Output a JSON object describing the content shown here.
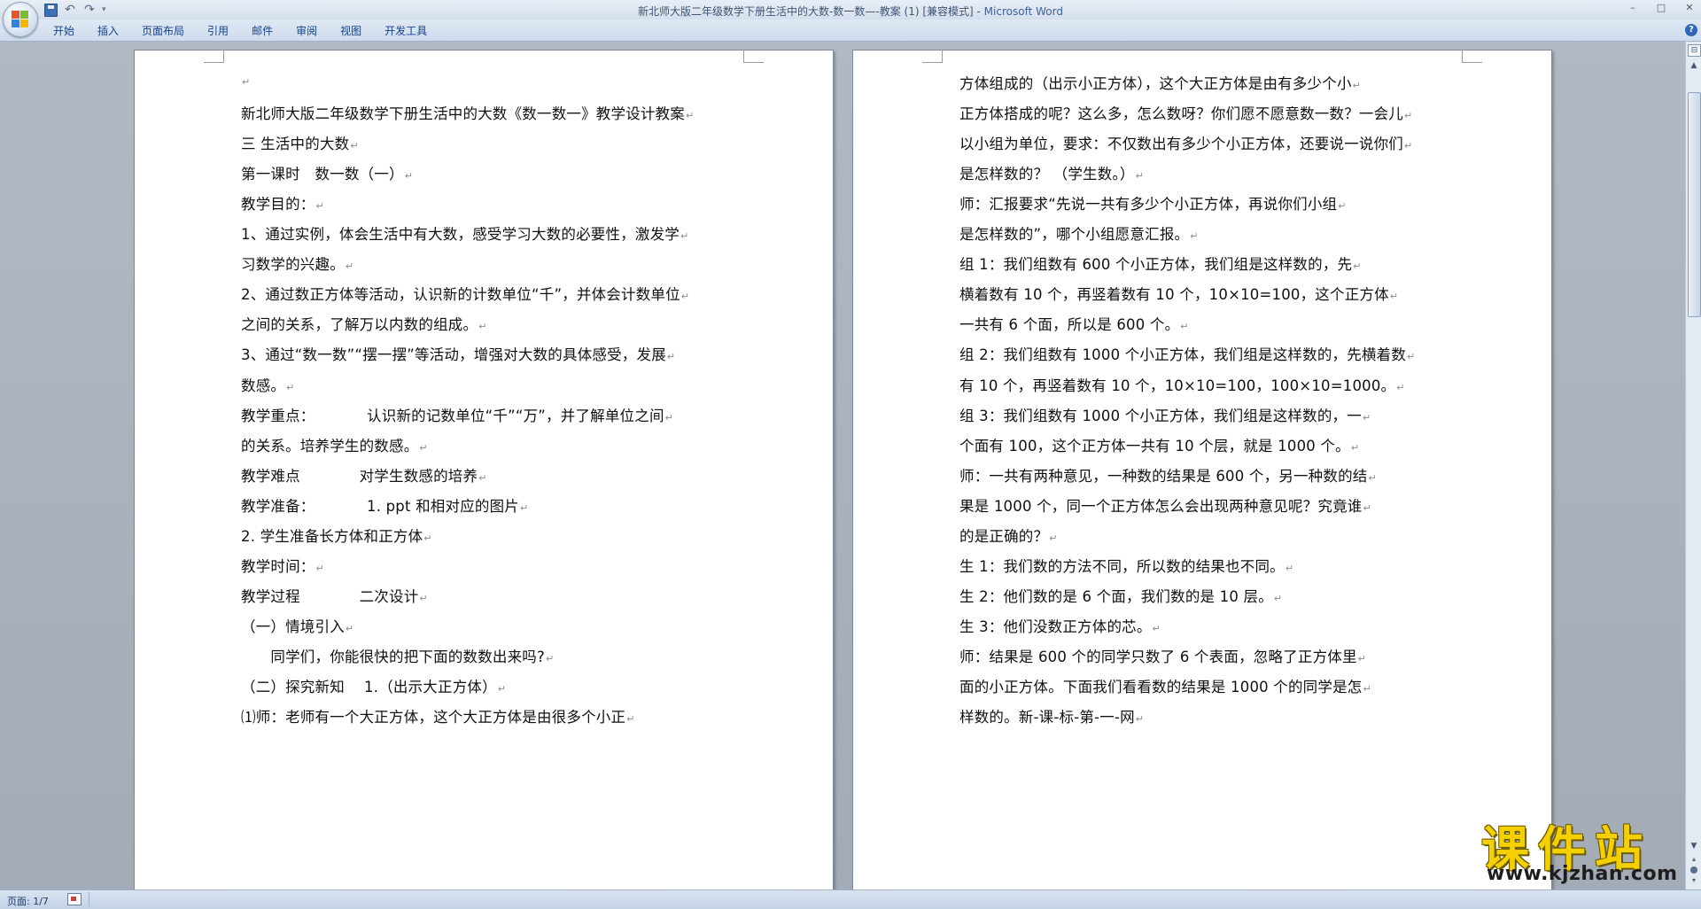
{
  "window": {
    "title_doc": "新北师大版二年级数学下册生活中的大数-数一数—-教案 (1) [兼容模式] - ",
    "title_app": "Microsoft Word",
    "controls": [
      "–",
      "□",
      "✕"
    ]
  },
  "quick_access": {
    "icons": [
      "save-icon",
      "undo-icon",
      "redo-icon",
      "customize-icon"
    ],
    "customize": "▾"
  },
  "ribbon": {
    "tabs": [
      "开始",
      "插入",
      "页面布局",
      "引用",
      "邮件",
      "审阅",
      "视图",
      "开发工具"
    ],
    "help": "?"
  },
  "pages": {
    "left": [
      "",
      "新北师大版二年级数学下册生活中的大数《数一数一》教学设计教案",
      "三 生活中的大数",
      "第一课时　数一数（一）",
      "教学目的：",
      "1、通过实例，体会生活中有大数，感受学习大数的必要性，激发学",
      "习数学的兴趣。",
      "2、通过数正方体等活动，认识新的计数单位“千”，并体会计数单位",
      "之间的关系，了解万以内数的组成。",
      "3、通过“数一数”“摆一摆”等活动，增强对大数的具体感受，发展",
      "数感。",
      "教学重点：　　　　认识新的记数单位“千”“万”，并了解单位之间",
      "的关系。培养学生的数感。",
      "教学难点　　　　对学生数感的培养",
      "教学准备：　　　　1. ppt 和相对应的图片",
      "2. 学生准备长方体和正方体",
      "教学时间：",
      "教学过程　　　　二次设计",
      "（一）情境引入",
      "　　同学们，你能很快的把下面的数数出来吗?",
      "（二）探究新知　 1.（出示大正方体）",
      "⑴师：老师有一个大正方体，这个大正方体是由很多个小正"
    ],
    "right": [
      "方体组成的（出示小正方体），这个大正方体是由有多少个小",
      "正方体搭成的呢？这么多，怎么数呀？你们愿不愿意数一数？一会儿",
      "以小组为单位，要求：不仅数出有多少个小正方体，还要说一说你们",
      "是怎样数的？ （学生数。）",
      "师：汇报要求“先说一共有多少个小正方体，再说你们小组",
      "是怎样数的”，哪个小组愿意汇报。",
      "组 1：我们组数有 600 个小正方体，我们组是这样数的，先",
      "横着数有 10 个，再竖着数有 10 个，10×10=100，这个正方体",
      "一共有 6 个面，所以是 600 个。",
      "组 2：我们组数有 1000 个小正方体，我们组是这样数的，先横着数",
      "有 10 个，再竖着数有 10 个，10×10=100，100×10=1000。",
      "组 3：我们组数有 1000 个小正方体，我们组是这样数的，一",
      "个面有 100，这个正方体一共有 10 个层，就是 1000 个。",
      "师：一共有两种意见，一种数的结果是 600 个，另一种数的结",
      "果是 1000 个，同一个正方体怎么会出现两种意见呢？究竟谁",
      "的是正确的？",
      "生 1：我们数的方法不同，所以数的结果也不同。",
      "生 2：他们数的是 6 个面，我们数的是 10 层。",
      "生 3：他们没数正方体的芯。",
      "师：结果是 600 个的同学只数了 6 个表面，忽略了正方体里",
      "面的小正方体。下面我们看看数的结果是 1000 个的同学是怎",
      "样数的。新-课-标-第-一-网"
    ],
    "paragraph_mark": "↵"
  },
  "scrollbar": {
    "ruler": "⊟",
    "up": "▲",
    "down": "▼",
    "prev": "▴",
    "next": "▾"
  },
  "status": {
    "page": "页面: 1/7"
  },
  "watermark": {
    "text": "课件站",
    "url": "www.kjzhan.com"
  },
  "colors": {
    "accent": "#15428b",
    "watermark_yellow": "#f5d000"
  }
}
